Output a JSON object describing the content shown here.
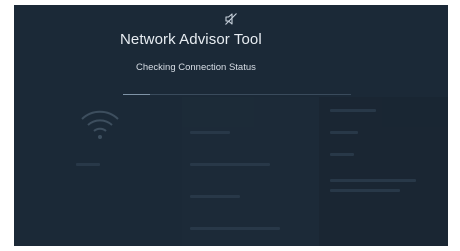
{
  "app": {
    "title": "Network Advisor Tool",
    "status": "Checking Connection Status"
  },
  "icons": {
    "mute": "speaker-muted-icon",
    "background": "wifi-icon"
  },
  "progress": {
    "fraction": 0.12
  },
  "colors": {
    "screen_bg": "#1b2937",
    "text": "#e8edf2",
    "progress_track": "#3a4b5c",
    "progress_fill": "#7f93a6"
  }
}
